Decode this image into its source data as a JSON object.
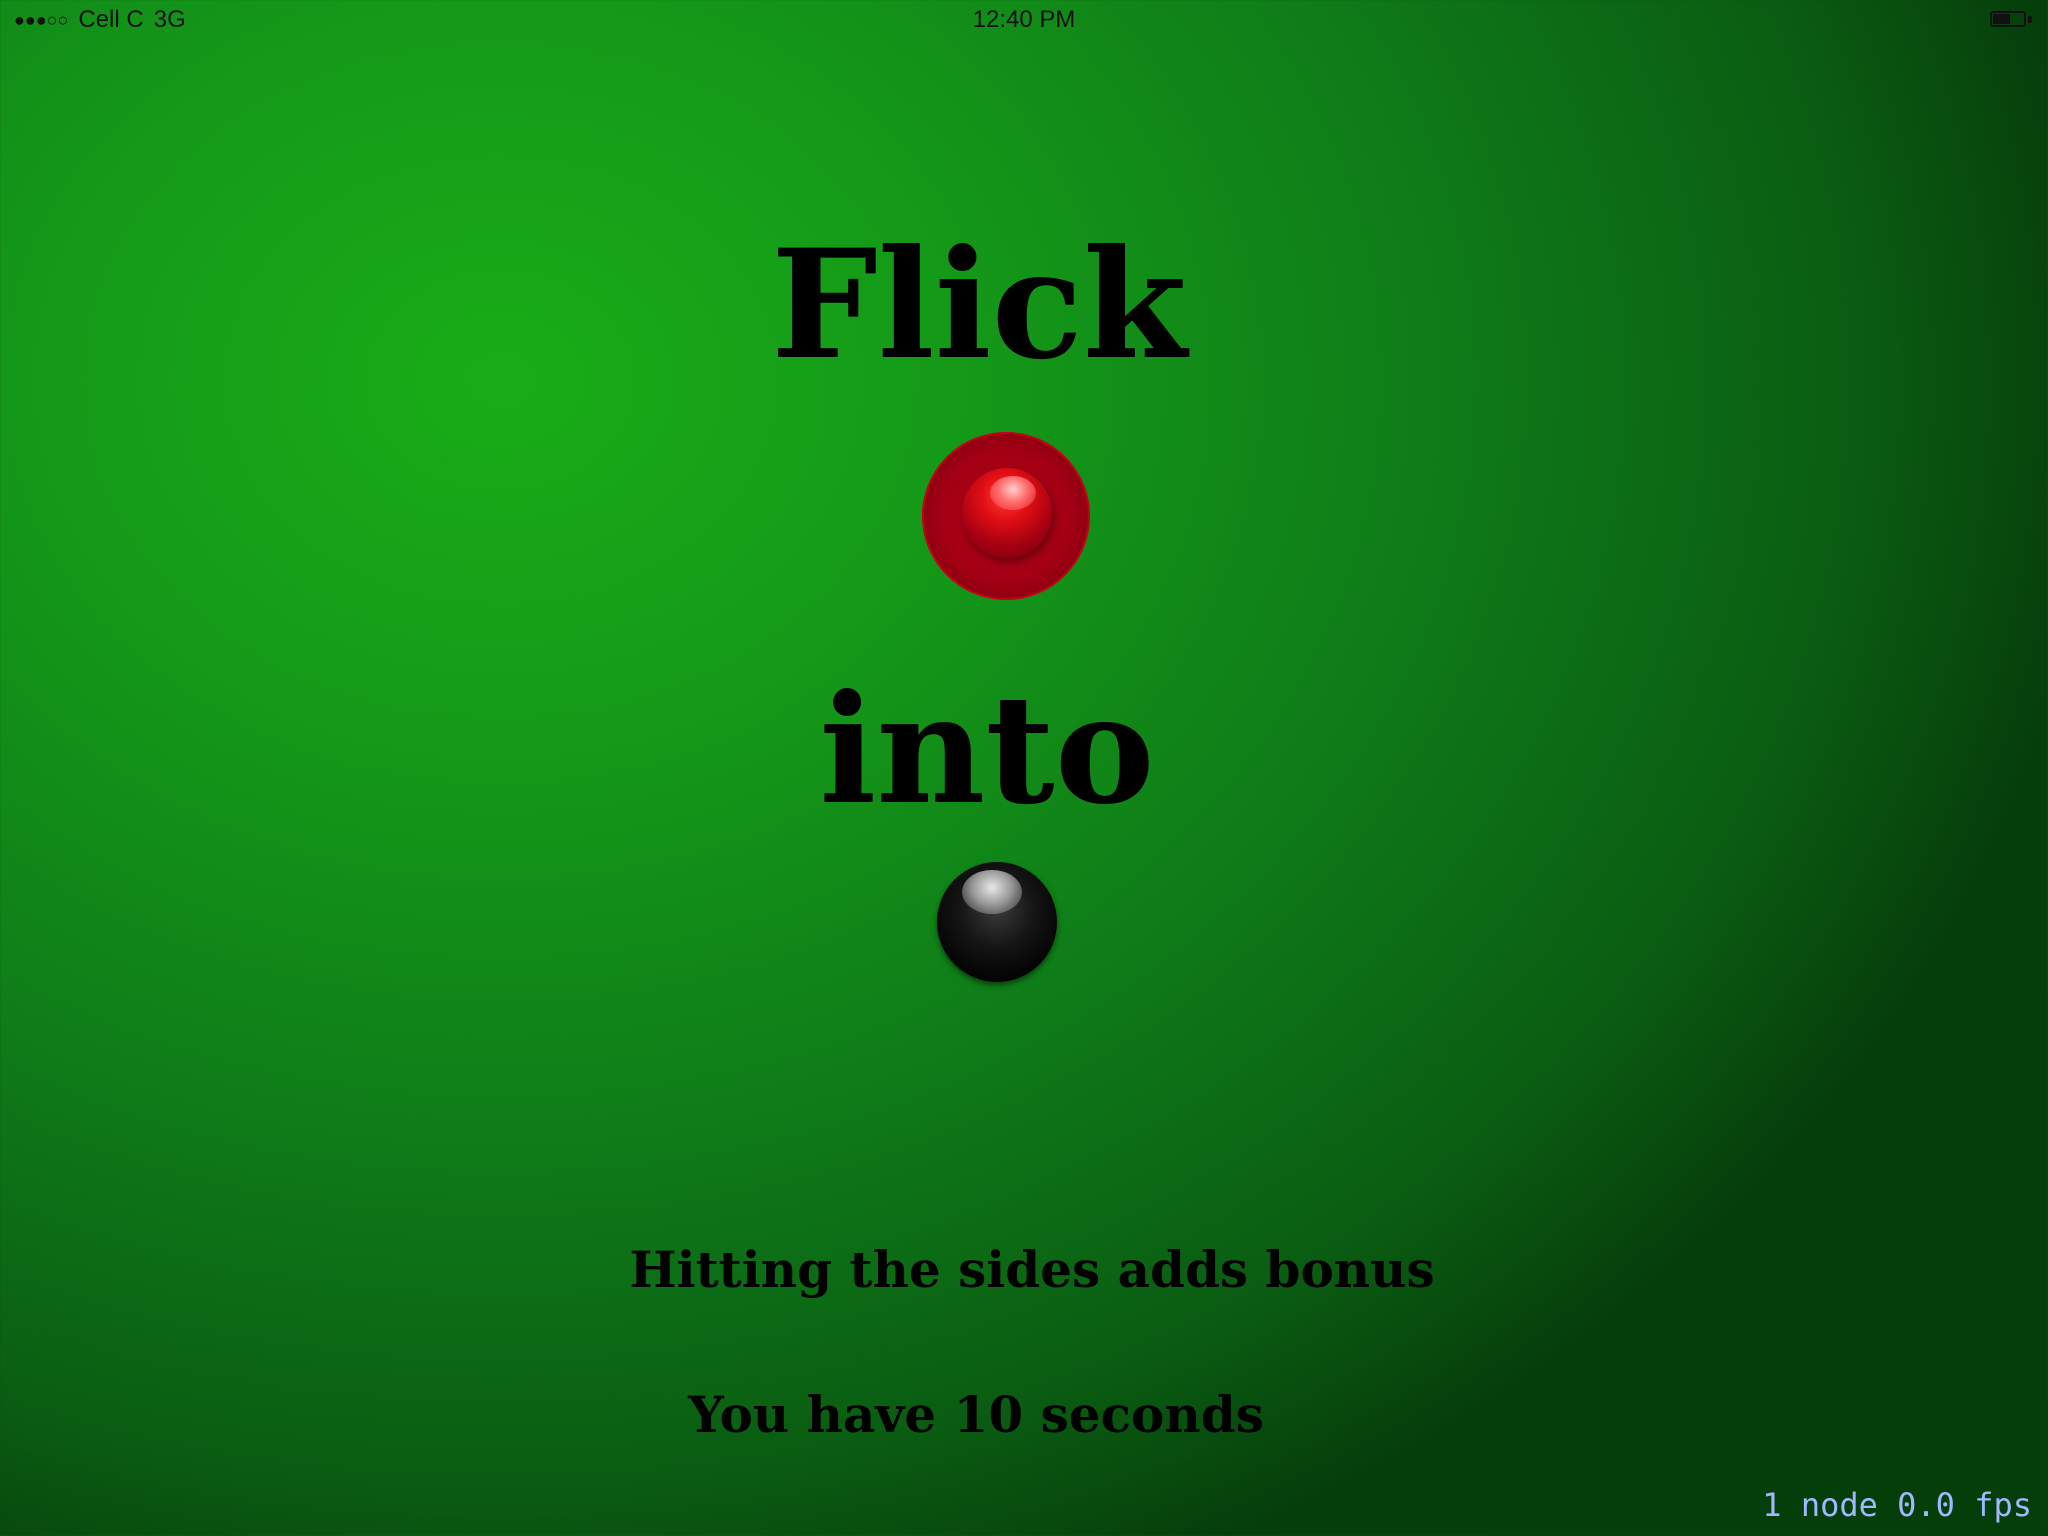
{
  "status_bar": {
    "signal": "●●●○○",
    "carrier": "Cell C",
    "network": "3G",
    "time": "12:40 PM",
    "battery_level": 0.55
  },
  "screen": {
    "title_top": "Flick",
    "title_middle": "into",
    "hint_bonus": "Hitting the sides adds bonus",
    "hint_time": "You have 10 seconds"
  },
  "debug_overlay": {
    "stats": "1 node 0.0 fps"
  },
  "colors": {
    "background_green": "#19ad17",
    "red_ball": "#e10520",
    "black_ball": "#000000",
    "debug_text": "#9fb8ff"
  },
  "icons": {
    "red_ball": "red-ball-icon",
    "black_ball": "black-ball-icon"
  }
}
